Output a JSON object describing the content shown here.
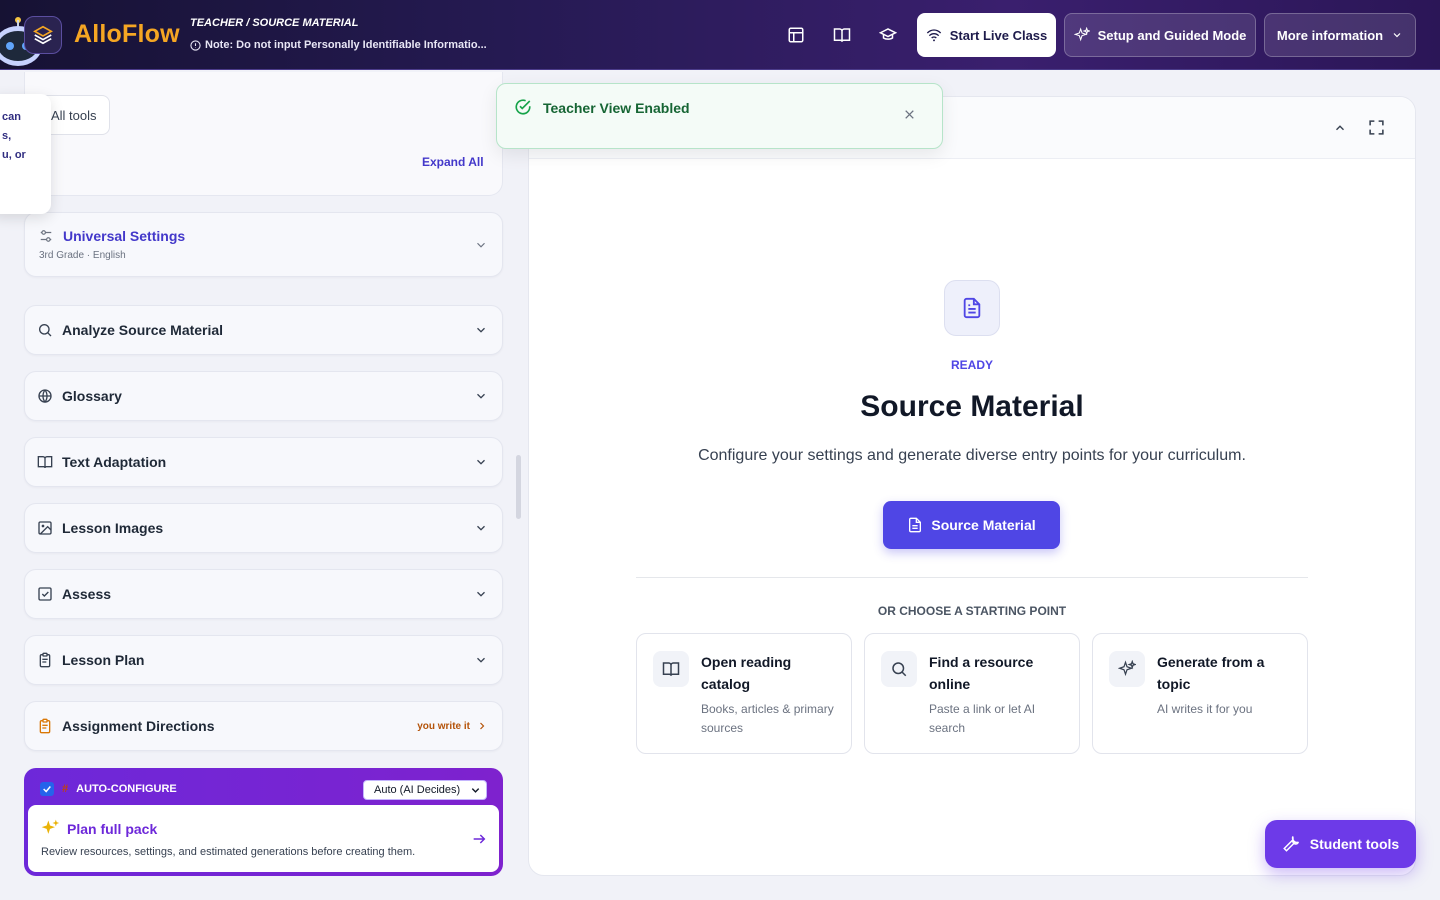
{
  "header": {
    "logo": "AlloFlow",
    "breadcrumb": "TEACHER / SOURCE MATERIAL",
    "notice": "Note: Do not input Personally Identifiable Informatio...",
    "icons": [
      "layout-icon",
      "book-icon",
      "graduation-cap-icon"
    ],
    "live_label": "Start Live Class",
    "setup_label": "Setup and Guided Mode",
    "more_label": "More information"
  },
  "tooltip": {
    "lines": [
      "can",
      "s,",
      "u, or"
    ]
  },
  "sidebar": {
    "all_tools": "All tools",
    "expand_all": "Expand All",
    "universal": {
      "label": "Universal Settings",
      "sub": "3rd Grade · English"
    },
    "items": [
      {
        "label": "Analyze Source Material"
      },
      {
        "label": "Glossary"
      },
      {
        "label": "Text Adaptation"
      },
      {
        "label": "Lesson Images"
      },
      {
        "label": "Assess"
      },
      {
        "label": "Lesson Plan"
      }
    ],
    "assignment": {
      "label": "Assignment Directions",
      "tag": "you write it"
    },
    "auto": {
      "label": "AUTO-CONFIGURE",
      "select_value": "Auto (AI Decides)",
      "plan_title": "Plan full pack",
      "plan_desc": "Review resources, settings, and estimated generations before creating them."
    }
  },
  "toast": {
    "message": "Teacher View Enabled"
  },
  "main": {
    "status": "READY",
    "title": "Source Material",
    "subtitle": "Configure your settings and generate diverse entry points for your curriculum.",
    "button": "Source Material",
    "or_label": "OR CHOOSE A STARTING POINT",
    "options": [
      {
        "title": "Open reading catalog",
        "desc": "Books, articles & primary sources"
      },
      {
        "title": "Find a resource online",
        "desc": "Paste a link or let AI search"
      },
      {
        "title": "Generate from a topic",
        "desc": "AI writes it for you"
      }
    ]
  },
  "student_tools": "Student tools",
  "colors": {
    "accent": "#4f46e5",
    "brand": "#f5a623",
    "purple": "#6d28d9",
    "success": "#166534"
  }
}
